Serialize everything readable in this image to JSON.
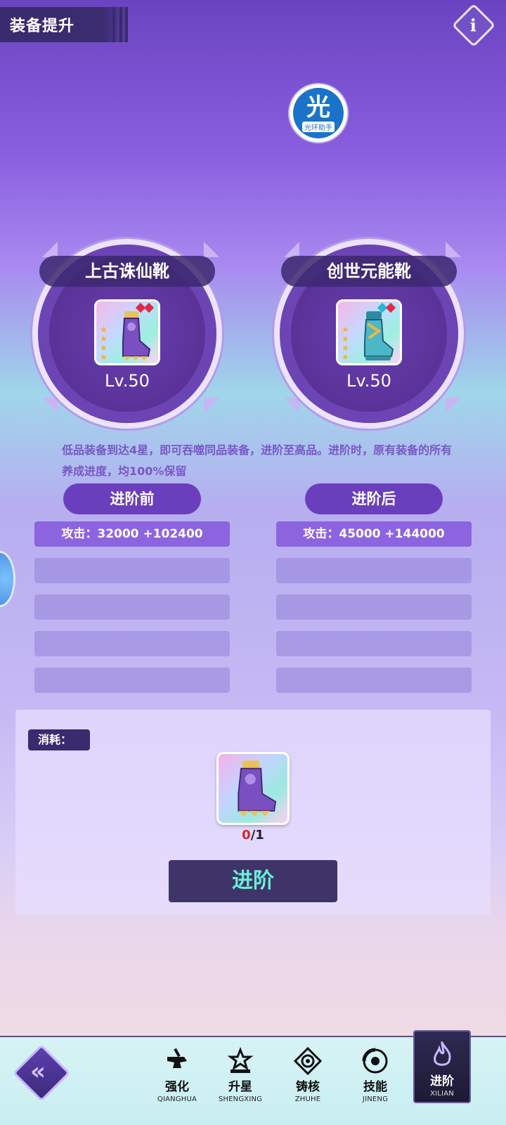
{
  "header": {
    "title": "装备提升",
    "info_icon": "info-icon",
    "info_glyph": "i"
  },
  "watermark": {
    "glyph": "光",
    "text": "光环助手"
  },
  "equipment": {
    "before": {
      "name": "上古诛仙靴",
      "level": "Lv.50",
      "stars": 4,
      "gems": [
        "red",
        "red"
      ]
    },
    "after": {
      "name": "创世元能靴",
      "level": "Lv.50",
      "stars": 4,
      "gems": [
        "red",
        "blue"
      ]
    }
  },
  "description": "低品装备到达4星，即可吞噬同品装备，进阶至高品。进阶时，原有装备的所有养成进度，均100%保留",
  "stats": {
    "before_label": "进阶前",
    "after_label": "进阶后",
    "before_attack": "攻击：32000 +102400",
    "after_attack": "攻击：45000 +144000"
  },
  "cost": {
    "label": "消耗：",
    "have": "0",
    "need": "/1",
    "button": "进阶"
  },
  "nav": {
    "back_glyph": "«",
    "items": [
      {
        "label": "强化",
        "sub": "QIANGHUA",
        "icon": "anvil-icon"
      },
      {
        "label": "升星",
        "sub": "SHENGXING",
        "icon": "star-upgrade-icon"
      },
      {
        "label": "铸核",
        "sub": "ZHUHE",
        "icon": "core-icon"
      },
      {
        "label": "技能",
        "sub": "JINENG",
        "icon": "skill-icon"
      },
      {
        "label": "进阶",
        "sub": "XILIAN",
        "icon": "flame-icon",
        "active": true
      }
    ]
  },
  "colors": {
    "accent": "#6a3fbd",
    "button_text": "#68f0d8",
    "panel_dark": "#3a2a6e"
  }
}
